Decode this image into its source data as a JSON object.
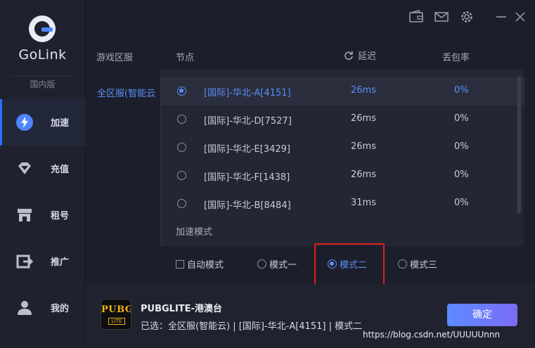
{
  "app": {
    "logo_text": "GoLink",
    "region_label": "国内版",
    "accent_color": "#5c8ff5"
  },
  "sidebar": {
    "items": [
      {
        "label": "加速",
        "icon": "lightning-icon",
        "active": true
      },
      {
        "label": "充值",
        "icon": "diamond-icon",
        "active": false
      },
      {
        "label": "租号",
        "icon": "store-icon",
        "active": false
      },
      {
        "label": "推广",
        "icon": "share-export-icon",
        "active": false
      },
      {
        "label": "我的",
        "icon": "user-icon",
        "active": false
      }
    ]
  },
  "topbar": {
    "icons": [
      "wallet-icon",
      "mail-icon",
      "gear-icon",
      "minimize-icon",
      "close-icon"
    ]
  },
  "table": {
    "headers": {
      "region": "游戏区服",
      "node": "节点",
      "latency": "延迟",
      "loss": "丢包率"
    },
    "regions": [
      "全区服(智能云"
    ],
    "rows": [
      {
        "name": "[国际]-华北-A[4151]",
        "latency": "26ms",
        "loss": "0%",
        "selected": true
      },
      {
        "name": "[国际]-华北-D[7527]",
        "latency": "26ms",
        "loss": "0%",
        "selected": false
      },
      {
        "name": "[国际]-华北-E[3429]",
        "latency": "26ms",
        "loss": "0%",
        "selected": false
      },
      {
        "name": "[国际]-华北-F[1438]",
        "latency": "26ms",
        "loss": "0%",
        "selected": false
      },
      {
        "name": "[国际]-华北-B[8484]",
        "latency": "31ms",
        "loss": "0%",
        "selected": false
      }
    ]
  },
  "modes": {
    "title": "加速模式",
    "auto_label": "自动模式",
    "options": [
      {
        "label": "模式一",
        "selected": false
      },
      {
        "label": "模式二",
        "selected": true
      },
      {
        "label": "模式三",
        "selected": false
      }
    ]
  },
  "footer": {
    "game_logo_top": "PUBG",
    "game_logo_bottom": "LITE",
    "game_name": "PUBGLITE-港澳台",
    "selected_text": "已选：全区服(智能云) | [国际]-华北-A[4151] | 模式二",
    "confirm_label": "确定",
    "watermark": "https://blog.csdn.net/UUUUUnnn"
  }
}
